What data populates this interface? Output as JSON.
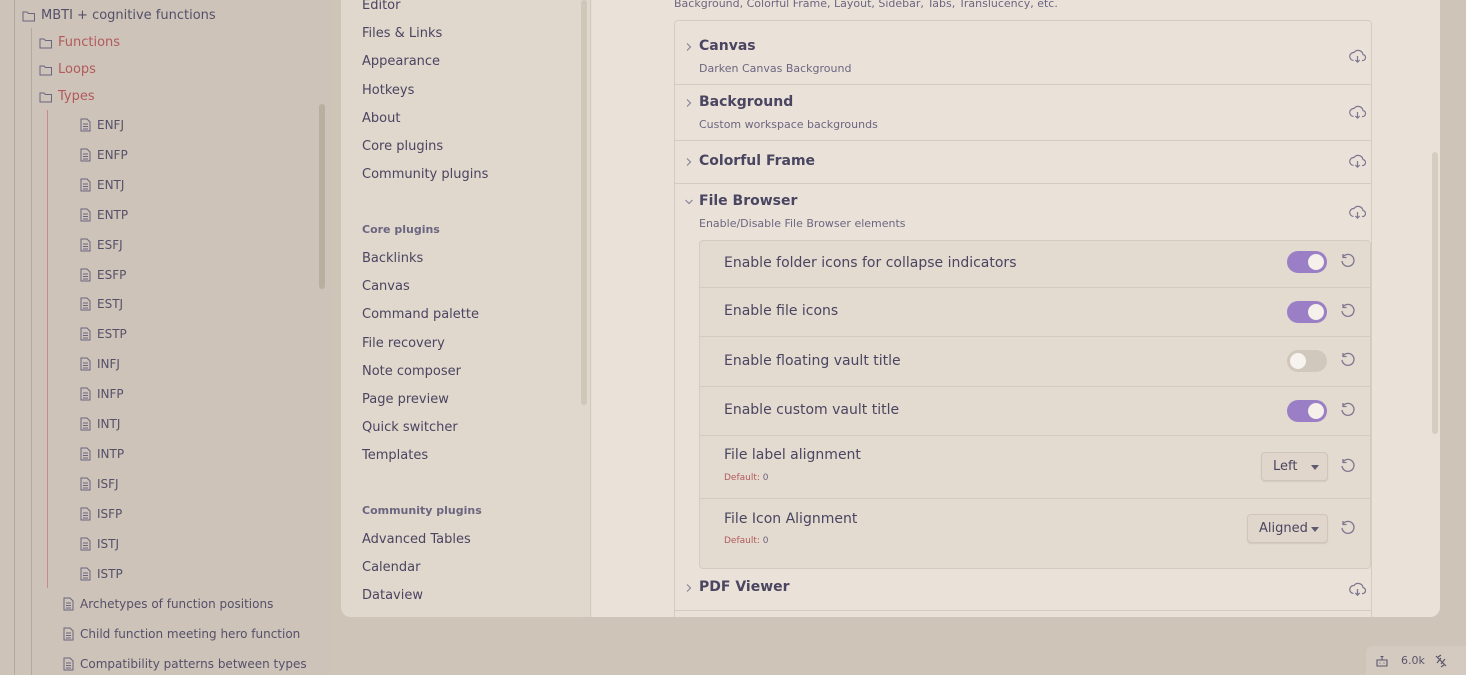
{
  "explorer": {
    "root_folder": "MBTI + cognitive functions",
    "folders": [
      {
        "label": "Functions"
      },
      {
        "label": "Loops"
      },
      {
        "label": "Types"
      }
    ],
    "types": [
      "ENFJ",
      "ENFP",
      "ENTJ",
      "ENTP",
      "ESFJ",
      "ESFP",
      "ESTJ",
      "ESTP",
      "INFJ",
      "INFP",
      "INTJ",
      "INTP",
      "ISFJ",
      "ISFP",
      "ISTJ",
      "ISTP"
    ],
    "notes": [
      "Archetypes of function positions",
      "Child function meeting hero function",
      "Compatibility patterns between types"
    ]
  },
  "settings_nav": {
    "options_items": [
      "Editor",
      "Files & Links",
      "Appearance",
      "Hotkeys",
      "About",
      "Core plugins",
      "Community plugins"
    ],
    "core_heading": "Core plugins",
    "core_items": [
      "Backlinks",
      "Canvas",
      "Command palette",
      "File recovery",
      "Note composer",
      "Page preview",
      "Quick switcher",
      "Templates"
    ],
    "community_heading": "Community plugins",
    "community_items": [
      "Advanced Tables",
      "Calendar",
      "Dataview"
    ]
  },
  "content": {
    "top_text": "Background, Colorful Frame, Layout, Sidebar, Tabs, Translucency, etc.",
    "sections": [
      {
        "title": "Canvas",
        "desc": "Darken Canvas Background"
      },
      {
        "title": "Background",
        "desc": "Custom workspace backgrounds"
      },
      {
        "title": "Colorful Frame",
        "desc": ""
      },
      {
        "title": "File Browser",
        "desc": "Enable/Disable File Browser elements"
      },
      {
        "title": "PDF Viewer",
        "desc": ""
      }
    ],
    "file_browser_settings": [
      {
        "name": "Enable folder icons for collapse indicators",
        "enabled": true
      },
      {
        "name": "Enable file icons",
        "enabled": true
      },
      {
        "name": "Enable floating vault title",
        "enabled": false
      },
      {
        "name": "Enable custom vault title",
        "enabled": true
      },
      {
        "name": "File label alignment",
        "default_label": "Default:",
        "default_value": "0",
        "selected": "Left"
      },
      {
        "name": "File Icon Alignment",
        "default_label": "Default:",
        "default_value": "0",
        "selected": "Aligned"
      }
    ]
  },
  "statusbar": {
    "count": "6.0k"
  },
  "colors": {
    "accent_toggle": "#9b7fc6",
    "folder_red": "#b25a5c",
    "default_hint": "#b25a5c"
  }
}
